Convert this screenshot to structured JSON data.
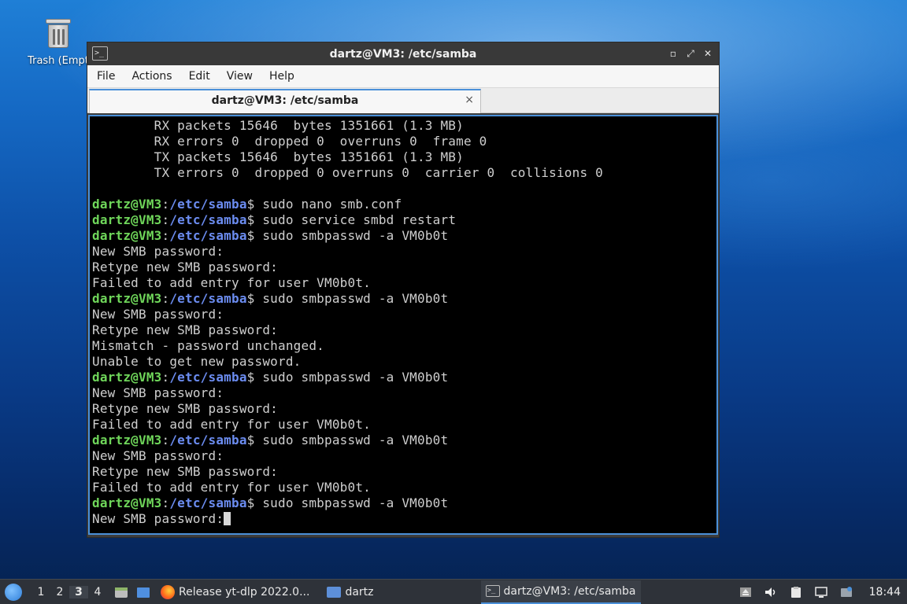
{
  "desktop": {
    "trash_label": "Trash (Empt"
  },
  "window": {
    "title": "dartz@VM3: /etc/samba",
    "menu": [
      "File",
      "Actions",
      "Edit",
      "View",
      "Help"
    ],
    "tab_label": "dartz@VM3: /etc/samba",
    "tab_close": "×",
    "controls": {
      "minimize": "▫",
      "maximize": "⤢",
      "close": "✕"
    }
  },
  "prompt": {
    "user": "dartz@VM3",
    "sep": ":",
    "path": "/etc/samba",
    "symbol": "$"
  },
  "terminal_lines": [
    {
      "type": "out",
      "text": "        RX packets 15646  bytes 1351661 (1.3 MB)"
    },
    {
      "type": "out",
      "text": "        RX errors 0  dropped 0  overruns 0  frame 0"
    },
    {
      "type": "out",
      "text": "        TX packets 15646  bytes 1351661 (1.3 MB)"
    },
    {
      "type": "out",
      "text": "        TX errors 0  dropped 0 overruns 0  carrier 0  collisions 0"
    },
    {
      "type": "out",
      "text": ""
    },
    {
      "type": "cmd",
      "text": " sudo nano smb.conf"
    },
    {
      "type": "cmd",
      "text": " sudo service smbd restart"
    },
    {
      "type": "cmd",
      "text": " sudo smbpasswd -a VM0b0t"
    },
    {
      "type": "out",
      "text": "New SMB password:"
    },
    {
      "type": "out",
      "text": "Retype new SMB password:"
    },
    {
      "type": "out",
      "text": "Failed to add entry for user VM0b0t."
    },
    {
      "type": "cmd",
      "text": " sudo smbpasswd -a VM0b0t"
    },
    {
      "type": "out",
      "text": "New SMB password:"
    },
    {
      "type": "out",
      "text": "Retype new SMB password:"
    },
    {
      "type": "out",
      "text": "Mismatch - password unchanged."
    },
    {
      "type": "out",
      "text": "Unable to get new password."
    },
    {
      "type": "cmd",
      "text": " sudo smbpasswd -a VM0b0t"
    },
    {
      "type": "out",
      "text": "New SMB password:"
    },
    {
      "type": "out",
      "text": "Retype new SMB password:"
    },
    {
      "type": "out",
      "text": "Failed to add entry for user VM0b0t."
    },
    {
      "type": "cmd",
      "text": " sudo smbpasswd -a VM0b0t"
    },
    {
      "type": "out",
      "text": "New SMB password:"
    },
    {
      "type": "out",
      "text": "Retype new SMB password:"
    },
    {
      "type": "out",
      "text": "Failed to add entry for user VM0b0t."
    },
    {
      "type": "cmd",
      "text": " sudo smbpasswd -a VM0b0t"
    },
    {
      "type": "cursor",
      "text": "New SMB password:"
    }
  ],
  "taskbar": {
    "workspaces": [
      "1",
      "2",
      "3",
      "4"
    ],
    "active_workspace": "3",
    "tasks": [
      {
        "label": "Release yt-dlp 2022.0...",
        "icon": "firefox-icon",
        "active": false
      },
      {
        "label": "dartz",
        "icon": "folder-icon",
        "active": false
      },
      {
        "label": "dartz@VM3: /etc/samba",
        "icon": "terminal-icon",
        "active": true
      }
    ],
    "clock": "18:44"
  }
}
